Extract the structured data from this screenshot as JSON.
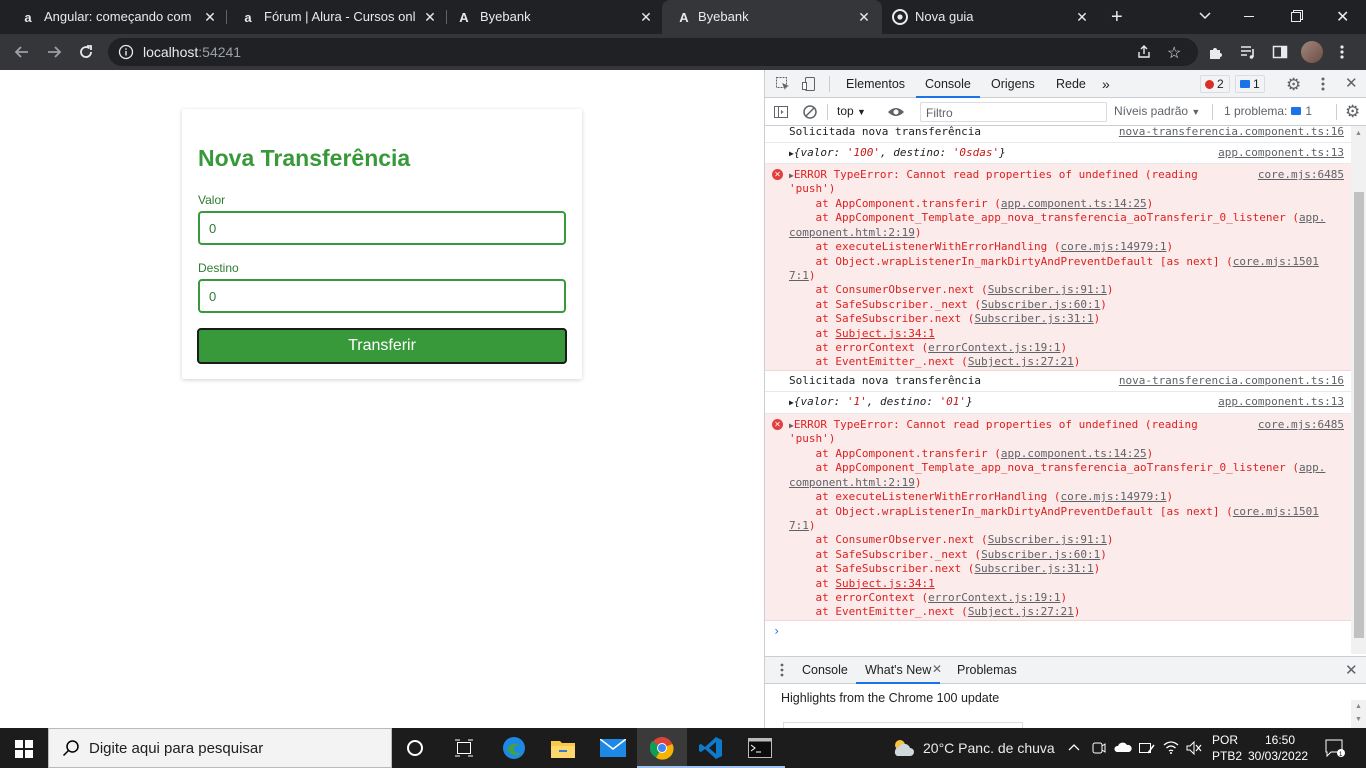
{
  "tabs": [
    {
      "title": "Angular: começando com o f",
      "favicon": "a"
    },
    {
      "title": "Fórum | Alura - Cursos online",
      "favicon": "a"
    },
    {
      "title": "Byebank",
      "favicon": "A"
    },
    {
      "title": "Byebank",
      "favicon": "A"
    },
    {
      "title": "Nova guia",
      "favicon": "chrome"
    }
  ],
  "address": {
    "host": "localhost",
    "port": ":54241"
  },
  "form": {
    "title": "Nova Transferência",
    "valor_label": "Valor",
    "valor_value": "0",
    "destino_label": "Destino",
    "destino_value": "0",
    "submit_label": "Transferir"
  },
  "devtools": {
    "tabs": [
      "Elementos",
      "Console",
      "Origens",
      "Rede",
      "»"
    ],
    "error_count": "2",
    "message_count": "1",
    "context": "top",
    "filter_placeholder": "Filtro",
    "levels": "Níveis padrão",
    "problems": "1 problema:",
    "problems_count": "1",
    "drawer_tabs": [
      "Console",
      "What's New",
      "Problemas"
    ],
    "drawer_text": "Highlights from the Chrome 100 update"
  },
  "console": {
    "log1": {
      "text": "Solicitada nova transferência",
      "source": "nova-transferencia.component.ts:16"
    },
    "obj1": {
      "prefix": "{",
      "k1": "valor",
      "v1": "'100'",
      "k2": "destino",
      "v2": "'0sdas'",
      "suffix": "}",
      "source": "app.component.ts:13"
    },
    "error1": {
      "line1": "ERROR TypeError: Cannot read properties of undefined (reading",
      "line2": "'push')",
      "source": "core.mjs:6485",
      "stack": [
        {
          "pre": "    at AppComponent.transferir (",
          "link": "app.component.ts:14:25",
          "post": ")"
        },
        {
          "pre": "    at AppComponent_Template_app_nova_transferencia_aoTransferir_0_listener (",
          "link": "app.",
          "post": ""
        },
        {
          "pre": "",
          "link": "component.html:2:19",
          "post": ")"
        },
        {
          "pre": "    at executeListenerWithErrorHandling (",
          "link": "core.mjs:14979:1",
          "post": ")"
        },
        {
          "pre": "    at Object.wrapListenerIn_markDirtyAndPreventDefault [as next] (",
          "link": "core.mjs:1501",
          "post": ""
        },
        {
          "pre": "",
          "link": "7:1",
          "post": ")"
        },
        {
          "pre": "    at ConsumerObserver.next (",
          "link": "Subscriber.js:91:1",
          "post": ")"
        },
        {
          "pre": "    at SafeSubscriber._next (",
          "link": "Subscriber.js:60:1",
          "post": ")"
        },
        {
          "pre": "    at SafeSubscriber.next (",
          "link": "Subscriber.js:31:1",
          "post": ")"
        },
        {
          "pre": "    at ",
          "link": "Subject.js:34:1",
          "post": ""
        },
        {
          "pre": "    at errorContext (",
          "link": "errorContext.js:19:1",
          "post": ")"
        },
        {
          "pre": "    at EventEmitter_.next (",
          "link": "Subject.js:27:21",
          "post": ")"
        }
      ]
    },
    "log2": {
      "text": "Solicitada nova transferência",
      "source": "nova-transferencia.component.ts:16"
    },
    "obj2": {
      "prefix": "{",
      "k1": "valor",
      "v1": "'1'",
      "k2": "destino",
      "v2": "'01'",
      "suffix": "}",
      "source": "app.component.ts:13"
    },
    "error2": {
      "line1": "ERROR TypeError: Cannot read properties of undefined (reading",
      "line2": "'push')",
      "source": "core.mjs:6485"
    }
  },
  "taskbar": {
    "search_placeholder": "Digite aqui para pesquisar",
    "weather_temp": "20°C",
    "weather_desc": "Panc. de chuva",
    "lang": "POR",
    "layout": "PTB2",
    "time": "16:50",
    "date": "30/03/2022"
  }
}
